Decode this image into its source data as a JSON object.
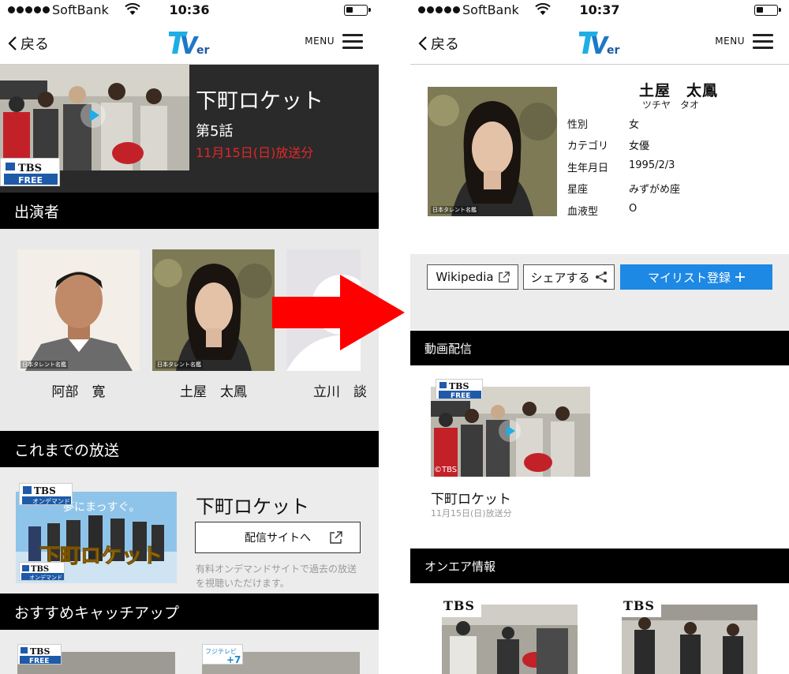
{
  "left": {
    "status": {
      "carrier": "SoftBank",
      "time": "10:36"
    },
    "nav": {
      "back": "戻る",
      "menu": "MENU"
    },
    "hero": {
      "title": "下町ロケット",
      "episode": "第5話",
      "date": "11月15日(日)放送分",
      "badge_top": "TBS",
      "badge_bottom": "FREE"
    },
    "cast_section": "出演者",
    "cast": [
      {
        "name": "阿部　寛",
        "credit": "日本タレント名鑑"
      },
      {
        "name": "土屋　太鳳",
        "credit": "日本タレント名鑑"
      },
      {
        "name": "立川　談"
      }
    ],
    "past_section": "これまでの放送",
    "past": {
      "title": "下町ロケット",
      "button": "配信サイトへ",
      "note": "有料オンデマンドサイトで過去の放送を視聴いただけます。",
      "badge_top": "TBS",
      "badge_bottom": "オンデマンド",
      "poster_text": "下町ロケット",
      "poster_sub": "夢にまっすぐ。"
    },
    "recommend_section": "おすすめキャッチアップ",
    "recommend": [
      {
        "badge_top": "TBS",
        "badge_bottom": "FREE"
      },
      {
        "badge_top": "フジテレビ",
        "badge_bottom": "+7"
      }
    ]
  },
  "right": {
    "status": {
      "carrier": "SoftBank",
      "time": "10:37"
    },
    "nav": {
      "back": "戻る",
      "menu": "MENU"
    },
    "profile": {
      "name": "土屋　太鳳",
      "kana": "ツチヤ　タオ",
      "credit": "日本タレント名鑑",
      "fields": [
        {
          "label": "性別",
          "value": "女"
        },
        {
          "label": "カテゴリ",
          "value": "女優"
        },
        {
          "label": "生年月日",
          "value": "1995/2/3"
        },
        {
          "label": "星座",
          "value": "みずがめ座"
        },
        {
          "label": "血液型",
          "value": "O"
        }
      ]
    },
    "actions": {
      "wikipedia": "Wikipedia",
      "share": "シェアする",
      "mylist": "マイリスト登録"
    },
    "video_section": "動画配信",
    "video": {
      "title": "下町ロケット",
      "date": "11月15日(日)放送分",
      "badge_top": "TBS",
      "badge_bottom": "FREE",
      "watermark": "©TBS"
    },
    "onair_section": "オンエア情報",
    "onair": [
      {
        "channel": "TBS"
      },
      {
        "channel": "TBS"
      }
    ]
  },
  "colors": {
    "accent_blue": "#1e88e5",
    "date_red": "#e0282a",
    "arrow_red": "#ff0000",
    "section_black": "#000000"
  }
}
